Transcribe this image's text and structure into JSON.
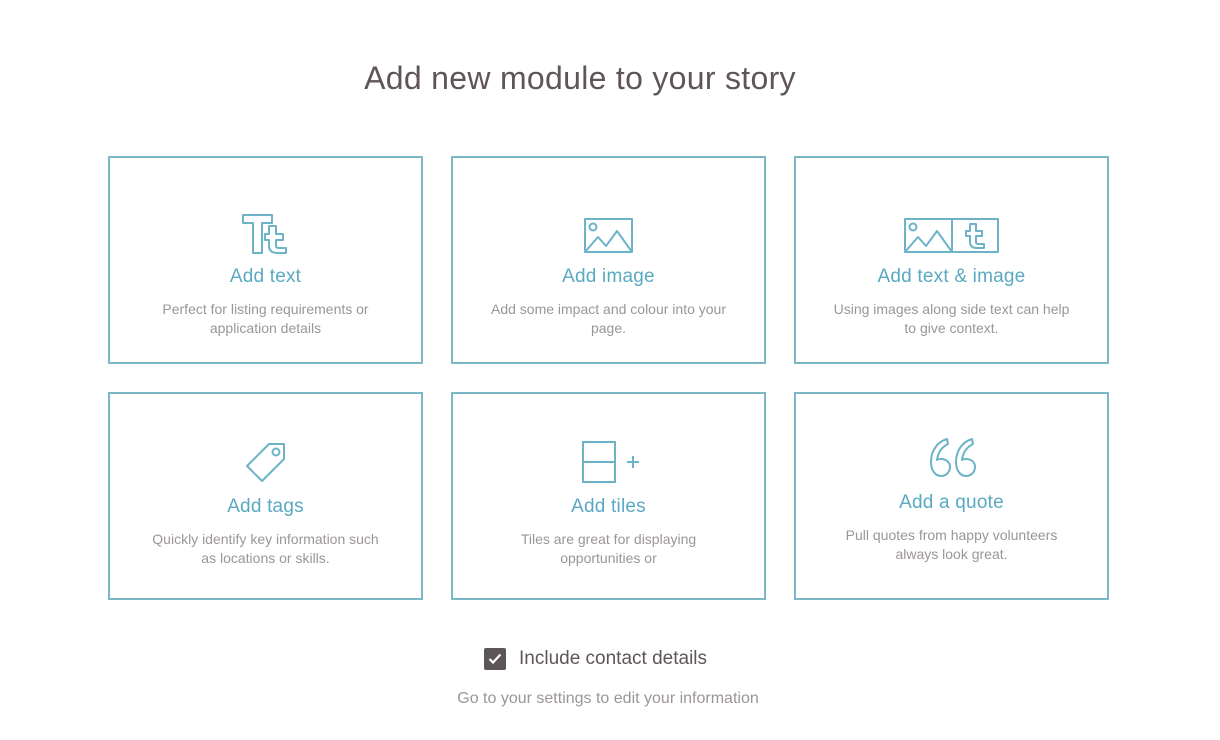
{
  "header": {
    "title": "Add new module to your story"
  },
  "modules": [
    {
      "title": "Add text",
      "description": "Perfect for listing requirements or application details",
      "icon": "text-format-icon"
    },
    {
      "title": "Add image",
      "description": "Add some impact and colour into your page.",
      "icon": "image-icon"
    },
    {
      "title": "Add text & image",
      "description": "Using images along side text can help to give context.",
      "icon": "text-image-icon"
    },
    {
      "title": "Add tags",
      "description": "Quickly identify key information such as locations or skills.",
      "icon": "tag-icon"
    },
    {
      "title": "Add tiles",
      "description": "Tiles are great for displaying opportunities or",
      "icon": "tiles-add-icon"
    },
    {
      "title": "Add a quote",
      "description": "Pull quotes from happy volunteers always look great.",
      "icon": "quote-icon"
    }
  ],
  "contact": {
    "label": "Include contact details",
    "checked": true
  },
  "footer": {
    "note": "Go to your settings to edit your information"
  },
  "colors": {
    "accent": "#7ab8c8",
    "title_text": "#5aa9c2",
    "heading": "#5f5559",
    "muted": "#9b9598"
  }
}
